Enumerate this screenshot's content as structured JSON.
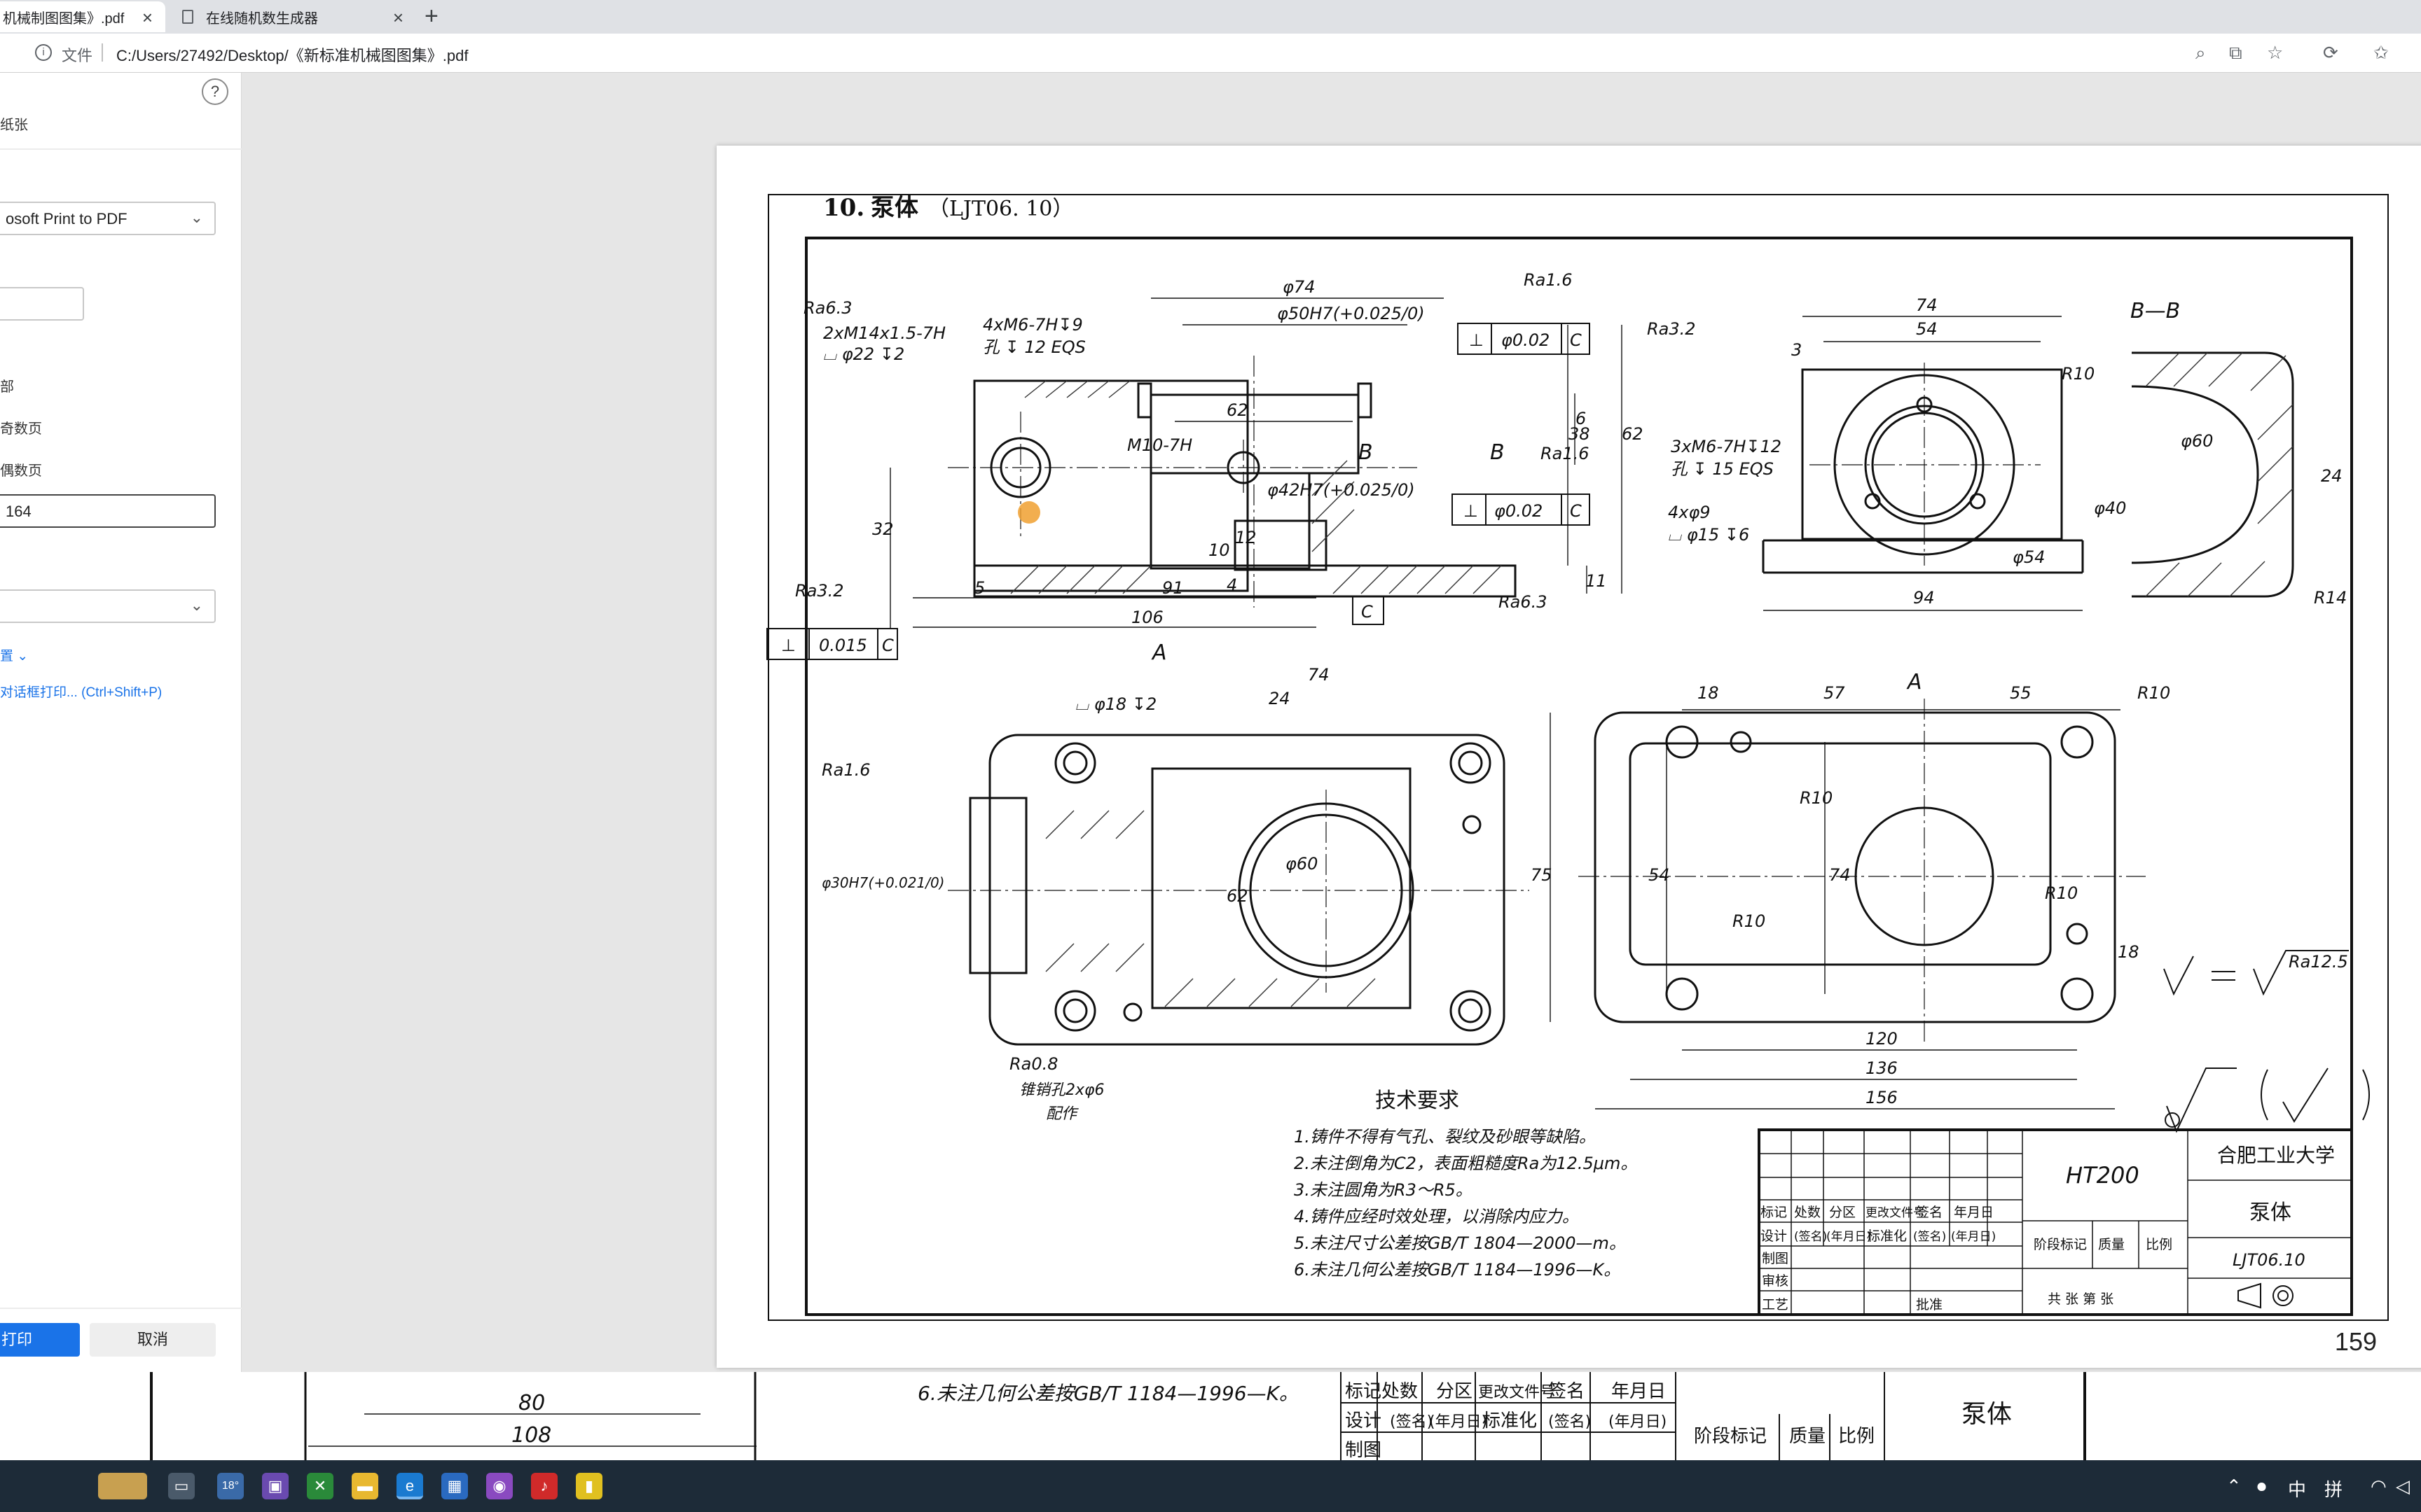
{
  "browser": {
    "tabs": [
      {
        "label": "机械制图图集》.pdf",
        "active": true
      },
      {
        "label": "在线随机数生成器",
        "active": false
      }
    ],
    "address": {
      "scheme_label": "文件",
      "url": "C:/Users/27492/Desktop/《新标准机械图图集》.pdf"
    }
  },
  "print_panel": {
    "title": "纸张",
    "printer": "osoft Print to PDF",
    "pages_options": [
      "部",
      "奇数页",
      "偶数页"
    ],
    "pages_value": "164",
    "settings_link": "置",
    "system_dialog_link": "对话框打印... (Ctrl+Shift+P)",
    "print_label": "打印",
    "cancel_label": "取消"
  },
  "page": {
    "heading_number": "10.",
    "heading_title": "泵体",
    "heading_code": "（LJT06. 10）",
    "page_number": "159",
    "tech_req_title": "技术要求",
    "tech_req": [
      "1.铸件不得有气孔、裂纹及砂眼等缺陷。",
      "2.未注倒角为C2，表面粗糙度Ra为12.5μm。",
      "3.未注圆角为R3～R5。",
      "4.铸件应经时效处理，以消除内应力。",
      "5.未注尺寸公差按GB/T 1804—2000—m。",
      "6.未注几何公差按GB/T 1184—1996—K。"
    ],
    "title_block": {
      "material": "HT200",
      "school": "合肥工业大学",
      "part": "泵体",
      "code": "LJT06.10",
      "header_cols": [
        "标记",
        "处数",
        "分区",
        "更改文件号",
        "签名",
        "年月日"
      ],
      "row_design": [
        "设计",
        "(签名)",
        "(年月日)",
        "标准化",
        "(签名)",
        "(年月日)"
      ],
      "rows": [
        "制图",
        "审核",
        "工艺"
      ],
      "approve": "批准",
      "stage": "阶段标记",
      "mass": "质量",
      "scale": "比例",
      "sheets": "共  张  第  张"
    },
    "annotations": {
      "ra63": "Ra6.3",
      "ra16": "Ra1.6",
      "ra32": "Ra3.2",
      "ra08": "Ra0.8",
      "ra125": "Ra12.5",
      "thread1": "2xM14x1.5-7H",
      "cbore1": "⌴ φ22 ↧2",
      "thread2": "4xM6-7H↧9",
      "thread2b": "孔 ↧ 12 EQS",
      "thread3": "M10-7H",
      "d74": "φ74",
      "d50": "φ50H7(+0.025/0)",
      "d42": "φ42H7(+0.025/0)",
      "tol_perp1": "φ0.02",
      "tol_perp2": "φ0.02",
      "tol_flat": "0.015",
      "datum": "C",
      "dim62": "62",
      "dim6": "6",
      "dim38": "38",
      "dim62v": "62",
      "dim11": "11",
      "dim32": "32",
      "dim5": "5",
      "dim91": "91",
      "dim106": "106",
      "dim10": "10",
      "dim12": "12",
      "dim4": "4",
      "sec_b": "B",
      "sec_a": "A",
      "tv_74": "74",
      "tv_54": "54",
      "tv_3": "3",
      "tv_r10": "R10",
      "tv_thread": "3xM6-7H↧12",
      "tv_thread_b": "孔 ↧ 15 EQS",
      "tv_holes": "4xφ9",
      "tv_cbore": "⌴ φ15 ↧6",
      "tv_d40": "φ40",
      "tv_d54": "φ54",
      "tv_94": "94",
      "bb_label": "B—B",
      "bb_d60": "φ60",
      "bb_24": "24",
      "bb_r14": "R14",
      "plan_74": "74",
      "plan_24": "24",
      "plan_cbore": "⌴ φ18 ↧2",
      "plan_d60": "φ60",
      "plan_62": "62",
      "plan_d30": "φ30H7(+0.021/0)",
      "plan_pin": "锥销孔2xφ6",
      "plan_pin2": "配作",
      "av_18": "18",
      "av_57": "57",
      "av_55": "55",
      "av_r10a": "R10",
      "av_r10b": "R10",
      "av_r10c": "R10",
      "av_r10d": "R10",
      "av_75": "75",
      "av_54": "54",
      "av_74": "74",
      "av_18b": "18",
      "av_120": "120",
      "av_136": "136",
      "av_156": "156",
      "av_a": "A"
    }
  },
  "bottom_page": {
    "dim80": "80",
    "dim108": "108",
    "note6": "6.未注几何公差按GB/T 1184—1996—K。",
    "cols": [
      "标记",
      "处数",
      "分区",
      "更改文件号",
      "签名",
      "年月日"
    ],
    "row": [
      "设计",
      "(签名)",
      "(年月日)",
      "标准化",
      "(签名)",
      "(年月日)"
    ],
    "row2": "制图",
    "stage": "阶段标记",
    "mass": "质量",
    "scale": "比例",
    "part": "泵体"
  },
  "taskbar": {
    "weather": "18°",
    "tray": [
      "中",
      "拼"
    ]
  },
  "colors": {
    "accent": "#1a73e8",
    "taskbar": "#1d2b38",
    "cursor": "#f0a030"
  }
}
